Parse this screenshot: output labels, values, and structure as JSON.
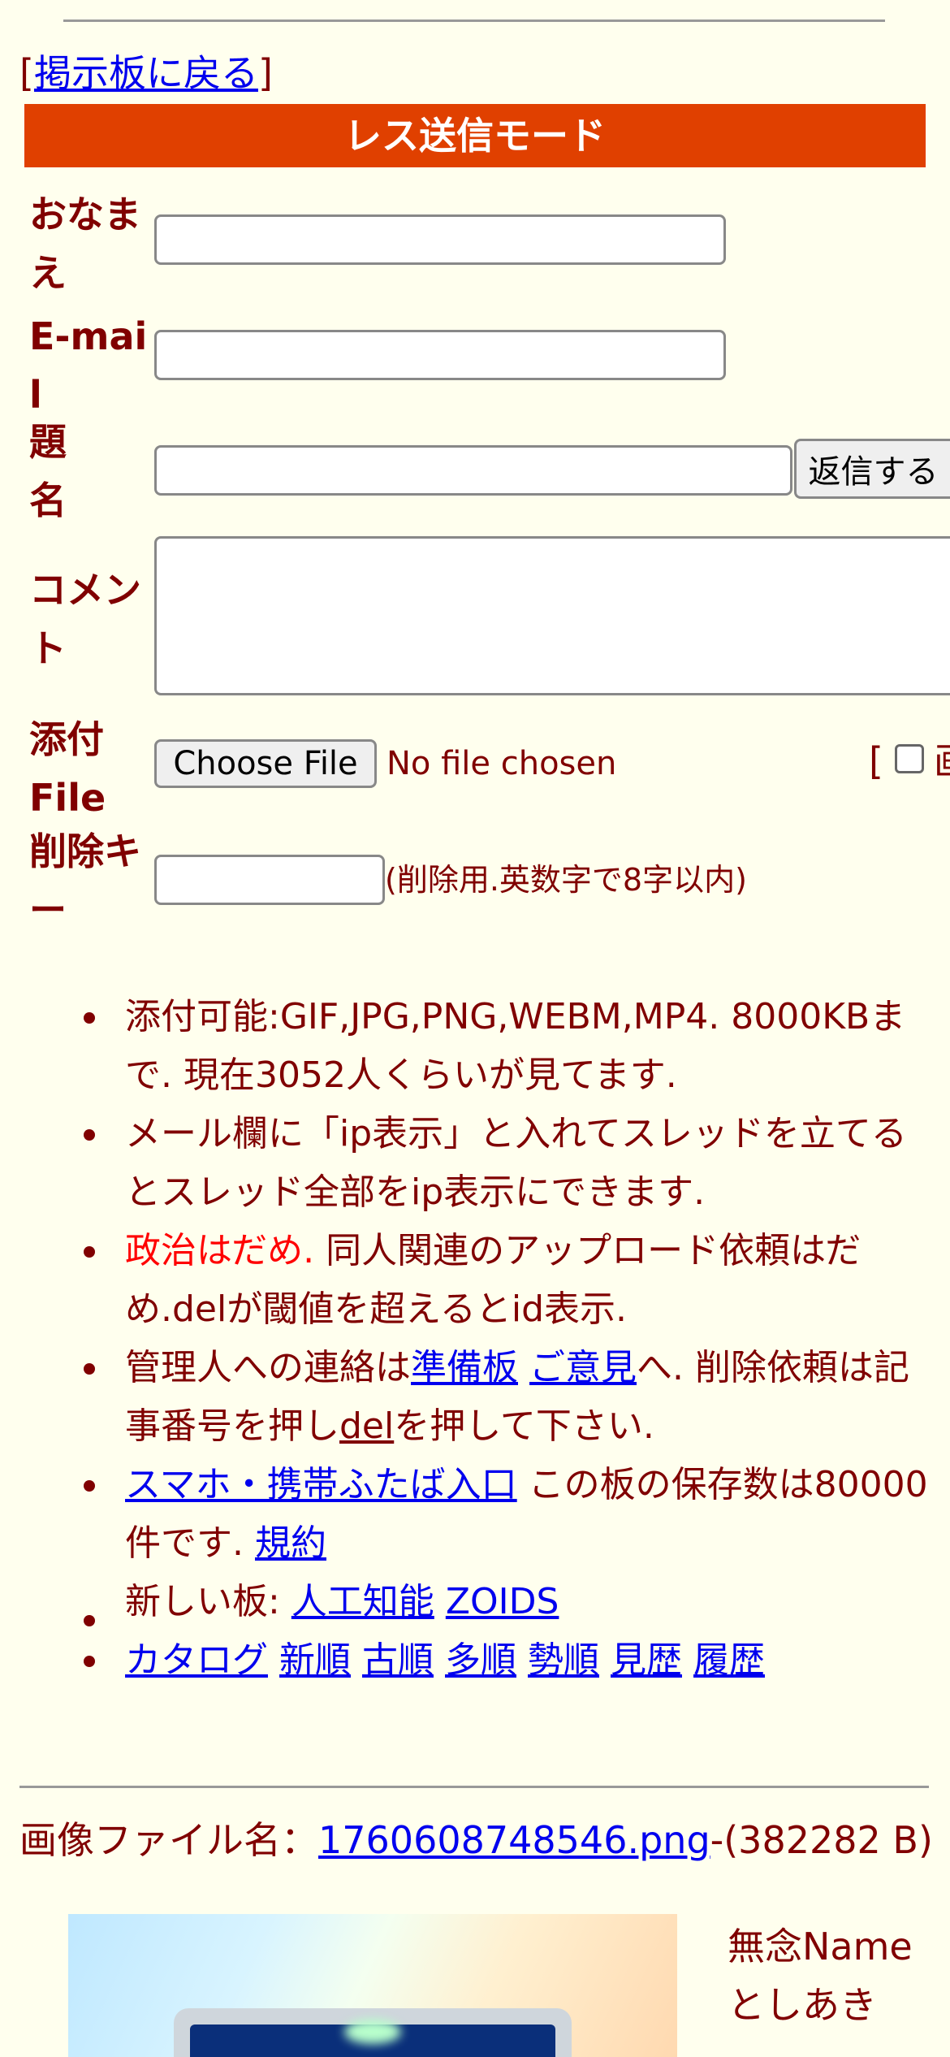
{
  "nav": {
    "open_bracket": "[",
    "back_link": "掲示板に戻る",
    "close_bracket": "]"
  },
  "banner": {
    "title": "レス送信モード"
  },
  "form": {
    "name_label": "おなまえ",
    "email_label": "E-mail",
    "subject_label": "題名",
    "submit_button": "返信する",
    "comment_label": "コメント",
    "attach_label": "添付File",
    "choose_file_button": "Choose File",
    "no_file_text": "No file chosen",
    "image_option_bracket": "[",
    "image_option_text": "画",
    "delete_key_label": "削除キー",
    "delete_key_note": "(削除用.英数字で8字以内)"
  },
  "rules": {
    "r1": "添付可能:GIF,JPG,PNG,WEBM,MP4. 8000KBまで. 現在3052人くらいが見てます.",
    "r2": "メール欄に「ip表示」と入れてスレッドを立てるとスレッド全部をip表示にできます.",
    "r3_red": "政治はだめ.",
    "r3_rest": " 同人関連のアップロード依頼はだめ.delが閾値を超えるとid表示.",
    "r4_pre": "管理人への連絡は",
    "r4_link1": "準備板",
    "r4_link2": "ご意見",
    "r4_mid": "へ. 削除依頼は記事番号を押し",
    "r4_link3": "del",
    "r4_post": "を押して下さい.",
    "r5_link": "スマホ・携帯ふたば入口",
    "r5_mid": " この板の保存数は80000件です. ",
    "r5_link2": "規約",
    "r6_label": "新しい板: ",
    "r6_link1": "人工知能",
    "r6_link2": "ZOIDS",
    "sort_links": [
      "カタログ",
      "新順",
      "古順",
      "多順",
      "勢順",
      "見歴",
      "履歴"
    ]
  },
  "post": {
    "file_label": "画像ファイル名：",
    "file_name": "1760608748546.png",
    "file_size": "-(382282 B)",
    "poster_name": "無念Name",
    "poster_extra": "としあき"
  },
  "colors": {
    "banner_bg": "#e04000",
    "page_bg": "#ffffee",
    "text": "#800000",
    "link": "#0000ee"
  }
}
